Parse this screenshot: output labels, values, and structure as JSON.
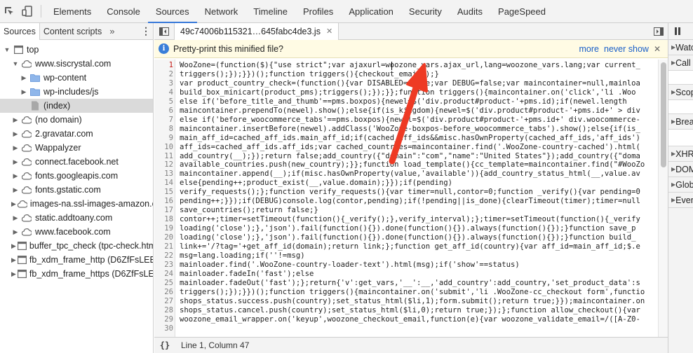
{
  "toolbar": {
    "tabs": [
      "Elements",
      "Console",
      "Sources",
      "Network",
      "Timeline",
      "Profiles",
      "Application",
      "Security",
      "Audits",
      "PageSpeed"
    ],
    "active_tab": "Sources"
  },
  "navigator": {
    "tabs": [
      "Sources",
      "Content scripts"
    ],
    "more": "»",
    "tree": [
      {
        "label": "top",
        "level": 0,
        "expanded": true,
        "icon": "frame-icon"
      },
      {
        "label": "www.siscrystal.com",
        "level": 1,
        "expanded": true,
        "icon": "cloud-icon"
      },
      {
        "label": "wp-content",
        "level": 2,
        "expanded": false,
        "icon": "folder-icon"
      },
      {
        "label": "wp-includes/js",
        "level": 2,
        "expanded": false,
        "icon": "folder-icon"
      },
      {
        "label": "(index)",
        "level": 2,
        "leaf": true,
        "icon": "file-icon",
        "selected": true
      },
      {
        "label": "(no domain)",
        "level": 1,
        "expanded": false,
        "icon": "cloud-icon"
      },
      {
        "label": "2.gravatar.com",
        "level": 1,
        "expanded": false,
        "icon": "cloud-icon"
      },
      {
        "label": "Wappalyzer",
        "level": 1,
        "expanded": false,
        "icon": "cloud-icon"
      },
      {
        "label": "connect.facebook.net",
        "level": 1,
        "expanded": false,
        "icon": "cloud-icon"
      },
      {
        "label": "fonts.googleapis.com",
        "level": 1,
        "expanded": false,
        "icon": "cloud-icon"
      },
      {
        "label": "fonts.gstatic.com",
        "level": 1,
        "expanded": false,
        "icon": "cloud-icon"
      },
      {
        "label": "images-na.ssl-images-amazon.c",
        "level": 1,
        "expanded": false,
        "icon": "cloud-icon"
      },
      {
        "label": "static.addtoany.com",
        "level": 1,
        "expanded": false,
        "icon": "cloud-icon"
      },
      {
        "label": "www.facebook.com",
        "level": 1,
        "expanded": false,
        "icon": "cloud-icon"
      },
      {
        "label": "buffer_tpc_check (tpc-check.htm",
        "level": 1,
        "expanded": false,
        "icon": "frame-icon"
      },
      {
        "label": "fb_xdm_frame_http (D6ZfFsLEB4",
        "level": 1,
        "expanded": false,
        "icon": "frame-icon"
      },
      {
        "label": "fb_xdm_frame_https (D6ZfFsLEB",
        "level": 1,
        "expanded": false,
        "icon": "frame-icon"
      }
    ]
  },
  "editor": {
    "file_tab": "49c74006b115321…645fabc4de3.js",
    "infobar": {
      "text": "Pretty-print this minified file?",
      "more": "more",
      "never_show": "never show"
    },
    "lines": [
      "WooZone=(function($){\"use strict\";var ajaxurl=woozone_vars.ajax_url,lang=woozone_vars.lang;var current_",
      "triggers();});}})();function triggers(){checkout_email();}",
      "var product_country_check=(function(){var DISABLED=false;var DEBUG=false;var maincontainer=null,mainloa",
      "build_box_minicart(product_pms);triggers();});}};function triggers(){maincontainer.on('click','li .Woo",
      "else if('before_title_and_thumb'==pms.boxpos){newel=$('div.product#product-'+pms.id);if(newel.length",
      "maincontainer.prependTo(newel).show();else{if(is_kingdom){newel=$('div.product#product-'+pms.id+' > div",
      "else if('before_woocommerce_tabs'==pms.boxpos){newel=$('div.product#product-'+pms.id+' div.woocommerce-",
      "maincontainer.insertBefore(newel).addClass('WooZone-boxpos-before_woocommerce_tabs').show();else{if(is_",
      "main_aff_id=cached_aff_ids.main_aff_id;if(cached_aff_ids&&misc.hasOwnProperty(cached_aff_ids,'aff_ids')",
      "aff_ids=cached_aff_ids.aff_ids;var cached_countries=maincontainer.find('.WooZone-country-cached').html(",
      "add_country(__);});return false;add_country({\"domain\":\"com\",\"name\":\"United States\"});add_country({\"doma",
      "available_countries.push(new_country);}};function load_template(){cc_template=maincontainer.find(\"#WooZo",
      "maincontainer.append(__);if(misc.hasOwnProperty(value,'available')){add_country_status_html(__,value.av",
      "else{pending++;product_exist(__,value.domain);}});if(pending)",
      "verify_requests();};function verify_requests(){var timer=null,contor=0;function _verify(){var pending=0",
      "pending++;}});if(DEBUG)console.log(contor,pending);if(!pending||is_done){clearTimeout(timer);timer=null",
      "save_countries();return false;}",
      "contor++;timer=setTimeout(function(){_verify();},verify_interval);};timer=setTimeout(function(){_verify",
      "loading('close');},'json').fail(function(){}).done(function(){}).always(function(){});}function save_p",
      "loading('close');},'json').fail(function(){}).done(function(){}).always(function(){});}function build_",
      "link+='/?tag='+get_aff_id(domain);return link;};function get_aff_id(country){var aff_id=main_aff_id;$.e",
      "msg=lang.loading;if(''!=msg)",
      "mainloader.find('.WooZone-country-loader-text').html(msg);if('show'==status)",
      "mainloader.fadeIn('fast');else",
      "mainloader.fadeOut('fast');};return{'v':get_vars,'__':__,'add_country':add_country,'set_product_data':s",
      "triggers();});}})();function triggers(){maincontainer.on('submit','li .WooZone-cc_checkout form',functio",
      "shops_status.success.push(country);set_status_html($li,1);form.submit();return true;}});maincontainer.on",
      "shops_status.cancel.push(country);set_status_html($li,0);return true;});};function allow_checkout(){var",
      "woozone_email_wrapper.on('keyup',woozone_checkout_email,function(e){var woozone_validate_email=/([A-Z0-",
      ""
    ]
  },
  "statusbar": {
    "braces": "{}",
    "position": "Line 1, Column 47"
  },
  "debugger": {
    "sections": [
      "Watch",
      "Call Stack",
      "Scope",
      "Breakpoints",
      "XHR Breakpoints",
      "DOM Breakpoints",
      "Global Listeners",
      "Event Listener Breakpoints"
    ]
  },
  "colors": {
    "accent": "#3879d9",
    "annotation_arrow": "#ee3a24",
    "infobar_bg": "#fffbe4",
    "selection": "#dadada"
  }
}
